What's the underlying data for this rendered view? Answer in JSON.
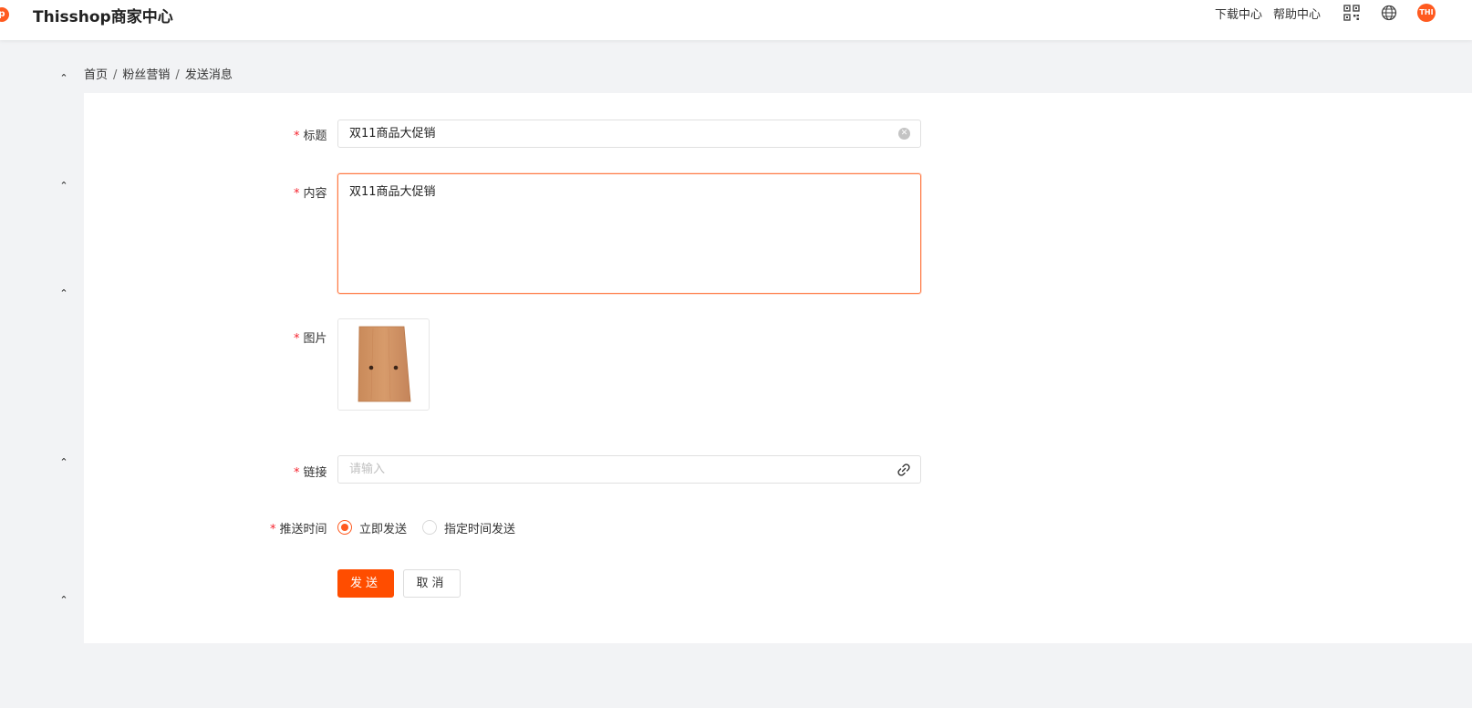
{
  "header": {
    "app_title": "Thisshop商家中心",
    "logo_glyph": "p",
    "links": {
      "download_center": "下载中心",
      "help_center": "帮助中心"
    },
    "icons": [
      "qrcode-icon",
      "globe-icon"
    ],
    "avatar_text": "THI",
    "accent": "#ff5a1f"
  },
  "breadcrumb": {
    "items": [
      "首页",
      "粉丝营销",
      "发送消息"
    ],
    "separator": "/"
  },
  "sidebar": {
    "caret_glyph": "⌃",
    "caret_count": 5
  },
  "form": {
    "required_mark": "*",
    "title": {
      "label": "标题",
      "value": "双11商品大促销"
    },
    "content": {
      "label": "内容",
      "value": "双11商品大促销"
    },
    "image": {
      "label": "图片"
    },
    "link": {
      "label": "链接",
      "placeholder": "请输入"
    },
    "push_time": {
      "label": "推送时间",
      "options": [
        "立即发送",
        "指定时间发送"
      ],
      "selected": "立即发送"
    },
    "buttons": {
      "submit": "发送",
      "cancel": "取消"
    }
  },
  "colors": {
    "primary": "#ff4d00",
    "focus_border": "#ff7a45",
    "required": "#f5222d",
    "page_bg": "#f2f3f5"
  }
}
